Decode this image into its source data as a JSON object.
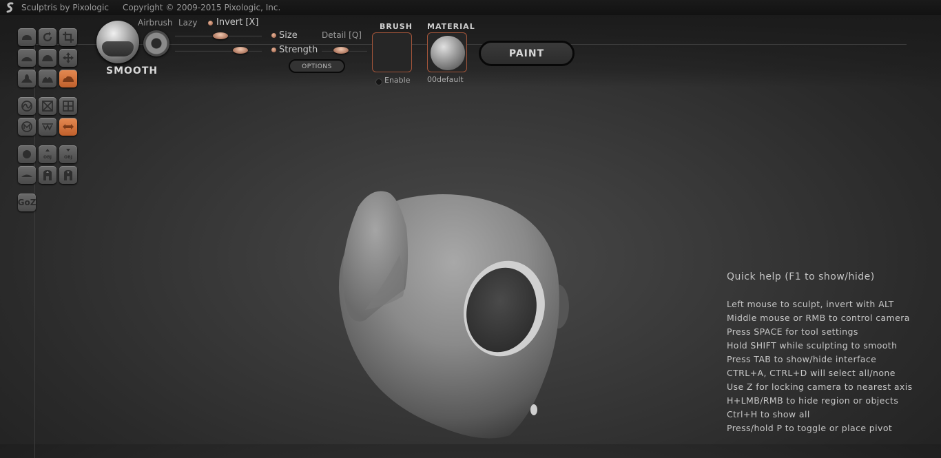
{
  "titlebar": {
    "app_name": "Sculptris by Pixologic",
    "copyright": "Copyright © 2009-2015 Pixologic, Inc."
  },
  "brush_panel": {
    "current_tool": "SMOOTH",
    "airbrush_label": "Airbrush",
    "lazy_label": "Lazy",
    "invert_label": "Invert [X]",
    "size_label": "Size",
    "strength_label": "Strength",
    "detail_label": "Detail [Q]",
    "options_label": "OPTIONS",
    "size_value": 0.48,
    "strength_value": 0.7,
    "detail_value": 0.45
  },
  "brush": {
    "title": "BRUSH",
    "enable_label": "Enable"
  },
  "material": {
    "title": "MATERIAL",
    "name": "00default"
  },
  "mode_button": "PAINT",
  "tools": {
    "goz_label": "GoZ",
    "obj_label": "OBJ"
  },
  "quick_help": {
    "title": "Quick help (F1 to show/hide)",
    "lines": [
      "Left mouse to sculpt, invert with ALT",
      "Middle mouse or RMB to control camera",
      "Press SPACE for tool settings",
      "Hold SHIFT while sculpting to smooth",
      "Press TAB to show/hide interface",
      "CTRL+A, CTRL+D will select all/none",
      "Use Z for locking camera to nearest axis",
      "H+LMB/RMB to hide region or objects",
      "Ctrl+H to show all",
      "Press/hold P to toggle or place pivot"
    ]
  },
  "colors": {
    "accent": "#d9733e",
    "background": "#333333",
    "model": "#8c8c8c"
  }
}
